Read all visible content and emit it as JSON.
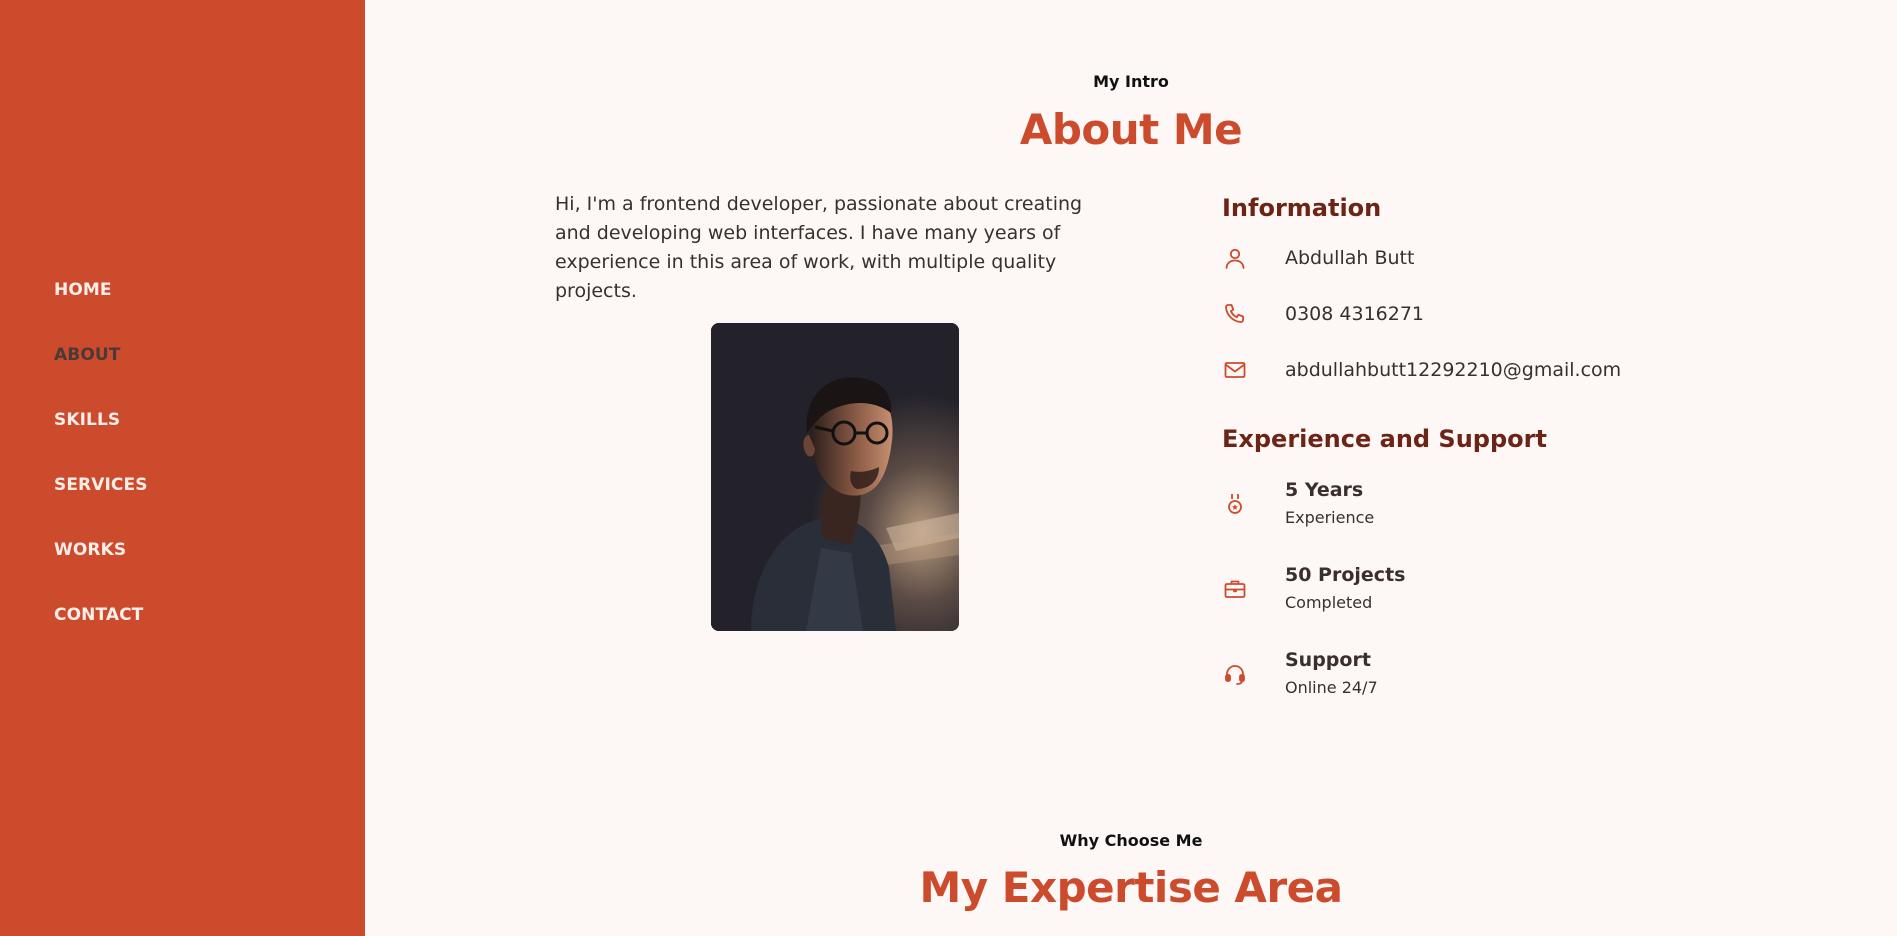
{
  "nav": {
    "items": [
      {
        "label": "HOME"
      },
      {
        "label": "ABOUT"
      },
      {
        "label": "SKILLS"
      },
      {
        "label": "SERVICES"
      },
      {
        "label": "WORKS"
      },
      {
        "label": "CONTACT"
      }
    ],
    "active": "ABOUT"
  },
  "about": {
    "eyebrow": "My Intro",
    "title": "About Me",
    "intro": "Hi, I'm a frontend developer, passionate about creating and developing web interfaces. I have many years of experience in this area of work, with multiple quality projects.",
    "information": {
      "heading": "Information",
      "name": "Abdullah Butt",
      "phone": "0308 4316271",
      "email": "abdullahbutt12292210@gmail.com"
    },
    "experience": {
      "heading": "Experience and Support",
      "items": [
        {
          "value": "5 Years",
          "caption": "Experience",
          "icon": "medal-icon"
        },
        {
          "value": "50 Projects",
          "caption": "Completed",
          "icon": "briefcase-icon"
        },
        {
          "value": "Support",
          "caption": "Online 24/7",
          "icon": "headset-icon"
        }
      ]
    }
  },
  "expertise": {
    "eyebrow": "Why Choose Me",
    "title": "My Expertise Area"
  },
  "colors": {
    "accent": "#cd4b2d",
    "heading_dark": "#6b2416",
    "background": "#fdf8f6"
  }
}
